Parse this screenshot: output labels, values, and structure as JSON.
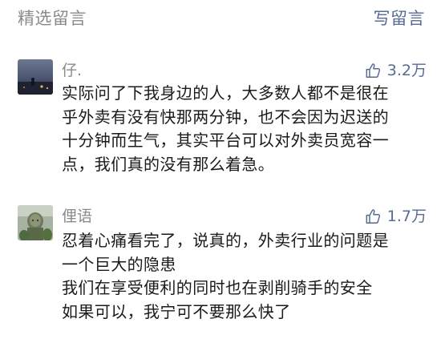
{
  "header": {
    "title": "精选留言",
    "write_label": "写留言"
  },
  "comments": [
    {
      "author": "仔.",
      "likes": "3.2万",
      "lines": [
        "实际问了下我身边的人，大多数人都不是很在",
        "乎外卖有没有快那两分钟，也不会因为迟送的",
        "十分钟而生气，其实平台可以对外卖员宽容一",
        "点，我们真的没有那么着急。"
      ]
    },
    {
      "author": "俚语",
      "likes": "1.7万",
      "lines": [
        "忍着心痛看完了，说真的，外卖行业的问题是",
        "一个巨大的隐患",
        "我们在享受便利的同时也在剥削骑手的安全",
        "如果可以，我宁可不要那么快了"
      ]
    }
  ],
  "icons": {
    "like": "thumbs-up-icon"
  },
  "colors": {
    "link": "#576b95",
    "muted_text": "#8a8a8a",
    "body_text": "#1a1a1a"
  }
}
